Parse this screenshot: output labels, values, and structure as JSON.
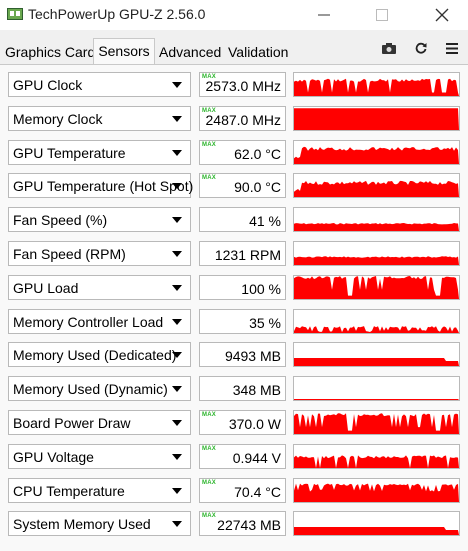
{
  "window": {
    "title": "TechPowerUp GPU-Z 2.56.0",
    "icon": "gpu-card-icon"
  },
  "tabs": [
    {
      "label": "Graphics Card",
      "active": false
    },
    {
      "label": "Sensors",
      "active": true
    },
    {
      "label": "Advanced",
      "active": false
    },
    {
      "label": "Validation",
      "active": false
    }
  ],
  "toolbar": {
    "icons": [
      "camera-icon",
      "refresh-icon",
      "menu-icon"
    ]
  },
  "colors": {
    "graph": "#ff0000",
    "max_tag": "#2db52d"
  },
  "max_tag_label": "MAX",
  "sensors": [
    {
      "name": "GPU Clock",
      "value": "2573.0 MHz",
      "max": true,
      "graph": {
        "level": 0.75,
        "pattern": "clock"
      }
    },
    {
      "name": "Memory Clock",
      "value": "2487.0 MHz",
      "max": true,
      "graph": {
        "level": 0.95,
        "pattern": "solid"
      }
    },
    {
      "name": "GPU Temperature",
      "value": "62.0 °C",
      "max": true,
      "graph": {
        "level": 0.75,
        "pattern": "temp"
      }
    },
    {
      "name": "GPU Temperature (Hot Spot)",
      "value": "90.0 °C",
      "max": true,
      "graph": {
        "level": 0.7,
        "pattern": "temp"
      }
    },
    {
      "name": "Fan Speed (%)",
      "value": "41 %",
      "max": false,
      "graph": {
        "level": 0.35,
        "pattern": "fan"
      }
    },
    {
      "name": "Fan Speed (RPM)",
      "value": "1231 RPM",
      "max": false,
      "graph": {
        "level": 0.38,
        "pattern": "fan"
      }
    },
    {
      "name": "GPU Load",
      "value": "100 %",
      "max": false,
      "graph": {
        "level": 1.0,
        "pattern": "load"
      }
    },
    {
      "name": "Memory Controller Load",
      "value": "35 %",
      "max": false,
      "graph": {
        "level": 0.3,
        "pattern": "mcload"
      }
    },
    {
      "name": "Memory Used (Dedicated)",
      "value": "9493 MB",
      "max": false,
      "graph": {
        "level": 0.35,
        "pattern": "memflat"
      }
    },
    {
      "name": "Memory Used (Dynamic)",
      "value": "348 MB",
      "max": false,
      "graph": {
        "level": 0.05,
        "pattern": "flat"
      }
    },
    {
      "name": "Board Power Draw",
      "value": "370.0 W",
      "max": true,
      "graph": {
        "level": 0.9,
        "pattern": "load"
      }
    },
    {
      "name": "GPU Voltage",
      "value": "0.944 V",
      "max": true,
      "graph": {
        "level": 0.55,
        "pattern": "clock"
      }
    },
    {
      "name": "CPU Temperature",
      "value": "70.4 °C",
      "max": true,
      "graph": {
        "level": 0.8,
        "pattern": "spiky"
      }
    },
    {
      "name": "System Memory Used",
      "value": "22743 MB",
      "max": true,
      "graph": {
        "level": 0.35,
        "pattern": "memflat"
      }
    }
  ]
}
